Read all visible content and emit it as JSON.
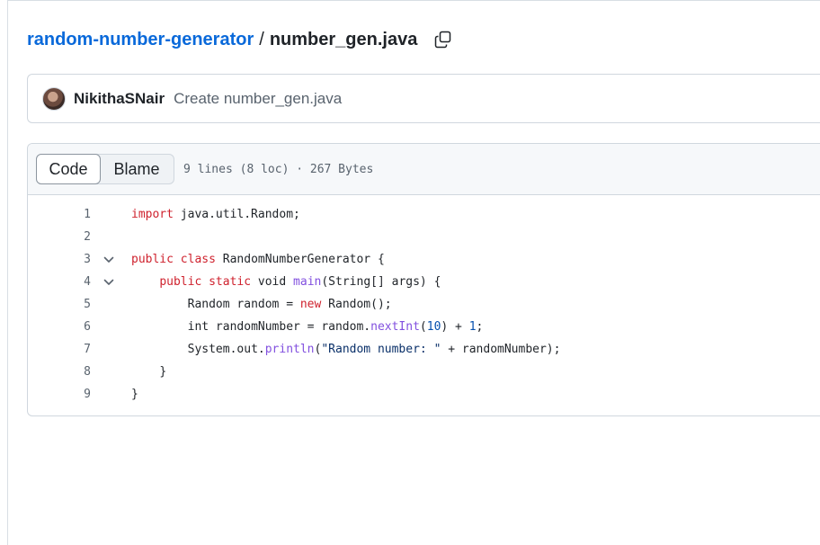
{
  "breadcrumb": {
    "repo": "random-number-generator",
    "separator": "/",
    "file": "number_gen.java"
  },
  "commit": {
    "author": "NikithaSNair",
    "message": "Create number_gen.java"
  },
  "file_header": {
    "code_tab": "Code",
    "blame_tab": "Blame",
    "meta": "9 lines (8 loc) · 267 Bytes"
  },
  "icons": {
    "copy": "copy-icon",
    "fold": "chevron-down-icon",
    "avatar": "user-avatar"
  },
  "colors": {
    "link": "#0969da",
    "keyword": "#cf222e",
    "function": "#8250df",
    "number": "#0550ae",
    "string": "#0a3069",
    "muted": "#59636e"
  },
  "code": {
    "line_numbers": [
      "1",
      "2",
      "3",
      "4",
      "5",
      "6",
      "7",
      "8",
      "9"
    ],
    "l1": {
      "kw": "import",
      "rest": " java.util.Random;"
    },
    "l3": {
      "kw1": "public",
      "kw2": "class",
      "rest": " RandomNumberGenerator {"
    },
    "l4": {
      "indent": "    ",
      "kw1": "public",
      "kw2": "static",
      "t1": " void ",
      "fn": "main",
      "t2": "(String[] args) {"
    },
    "l5": {
      "indent": "        ",
      "t1": "Random random = ",
      "kw": "new",
      "t2": " Random();"
    },
    "l6": {
      "indent": "        ",
      "t1": "int randomNumber = random.",
      "fn": "nextInt",
      "t2": "(",
      "num1": "10",
      "t3": ") + ",
      "num2": "1",
      "t4": ";"
    },
    "l7": {
      "indent": "        ",
      "t1": "System.out.",
      "fn": "println",
      "t2": "(",
      "str": "\"Random number: \"",
      "t3": " + randomNumber);"
    },
    "l8": {
      "indent": "    ",
      "t1": "}"
    },
    "l9": {
      "t1": "}"
    }
  }
}
